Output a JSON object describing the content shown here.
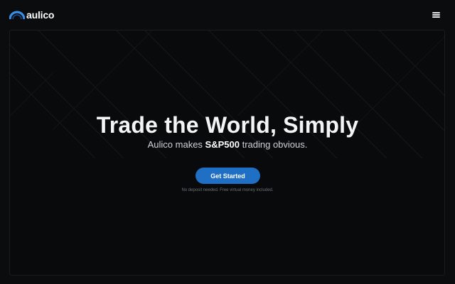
{
  "header": {
    "logo_text": "aulico",
    "logo_icon": "arc-icon",
    "menu_icon": "hamburger-icon"
  },
  "hero": {
    "title": "Trade the World, Simply",
    "subtitle_prefix": "Aulico makes ",
    "subtitle_emphasis": "S&P500",
    "subtitle_suffix": " trading obvious.",
    "cta_label": "Get Started",
    "note": "No deposit needed. Free virtual money included."
  },
  "colors": {
    "background": "#0b0c0d",
    "accent": "#1f6fc5",
    "text": "#ffffff"
  }
}
